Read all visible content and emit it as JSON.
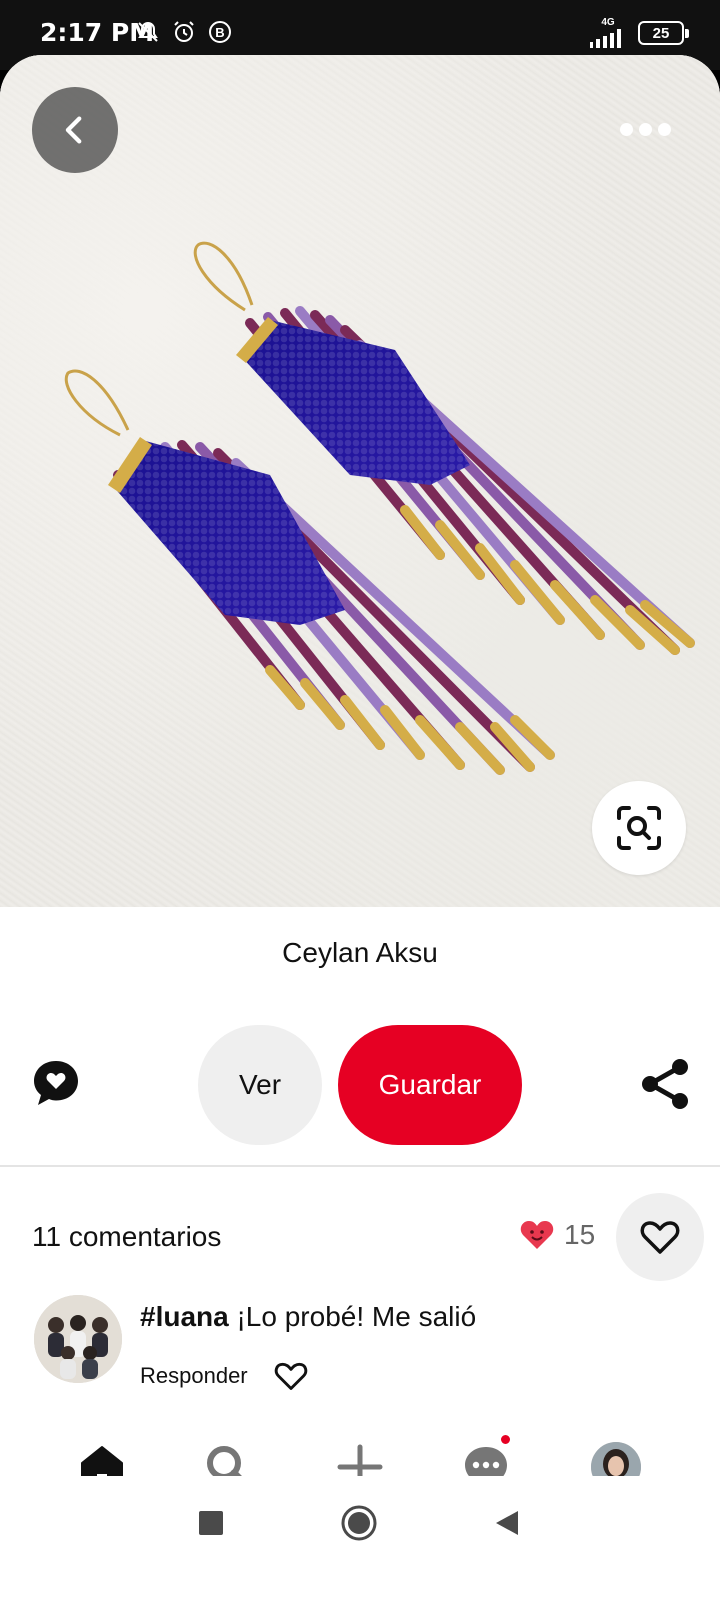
{
  "status_bar": {
    "time": "2:17 PM",
    "network": "4G",
    "battery": "25"
  },
  "pin": {
    "author": "Ceylan Aksu",
    "view_label": "Ver",
    "save_label": "Guardar"
  },
  "comments": {
    "count_label": "11 comentarios",
    "reaction_count": "15",
    "items": [
      {
        "user": "#luana",
        "text": "¡Lo probé! Me salió",
        "reply_label": "Responder"
      }
    ]
  },
  "colors": {
    "accent": "#e60023",
    "button_bg": "#efefef"
  },
  "icons": [
    "back-icon",
    "more-icon",
    "visual-search-icon",
    "comment-icon",
    "share-icon",
    "heart-icon",
    "home-icon",
    "search-icon",
    "plus-icon",
    "messages-icon"
  ]
}
